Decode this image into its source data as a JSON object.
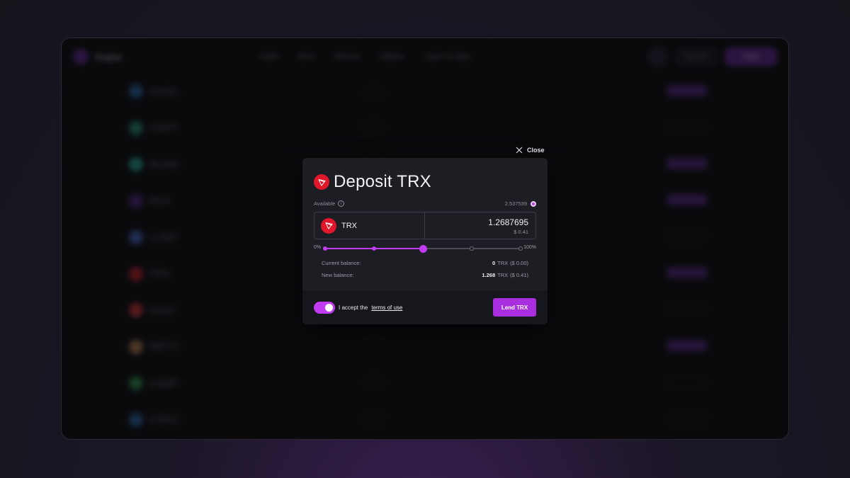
{
  "background": {
    "nav": {
      "brand": "Kujira",
      "menu": [
        "Trade",
        "Earn",
        "Borrow",
        "Utilities",
        "Learn & Help"
      ],
      "search_label": "Search",
      "start_label": "Start"
    },
    "rows": [
      {
        "coin": "USDC",
        "icon_color": "#2f6fb0",
        "cta": true
      },
      {
        "coin": "USDT",
        "icon_color": "#2a9a77",
        "cta": false
      },
      {
        "coin": "RUNE",
        "icon_color": "#26b7a5",
        "cta": true
      },
      {
        "coin": "MLA",
        "icon_color": "#5b2d8c",
        "cta": true
      },
      {
        "coin": "LUSD",
        "icon_color": "#4a6fd0",
        "cta": false
      },
      {
        "coin": "TRX",
        "icon_color": "#d02230",
        "cta": true
      },
      {
        "coin": "AVAX",
        "icon_color": "#e03a3a",
        "cta": false
      },
      {
        "coin": "WETC",
        "icon_color": "#c58a55",
        "cta": true
      },
      {
        "coin": "USDP",
        "icon_color": "#2e9a4a",
        "cta": false
      },
      {
        "coin": "USDC",
        "icon_color": "#2f6fb0",
        "cta": false
      }
    ]
  },
  "close_label": "Close",
  "modal": {
    "title": "Deposit TRX",
    "available_label": "Available",
    "available_value": "2.537539",
    "asset_symbol": "TRX",
    "amount_value": "1.2687695",
    "amount_usd": "$ 0.41",
    "slider": {
      "min_label": "0%",
      "max_label": "100%",
      "value_fraction": 0.5,
      "ticks": [
        0,
        0.25,
        0.5,
        0.75,
        1
      ]
    },
    "current_balance_label": "Current balance:",
    "current_balance_value": "0",
    "current_balance_unit": "TRX",
    "current_balance_usd": "($ 0.00)",
    "new_balance_label": "New balance:",
    "new_balance_value": "1.268",
    "new_balance_unit": "TRX",
    "new_balance_usd": "($ 0.41)",
    "accept_prefix": "I accept the",
    "terms_link": "terms of use",
    "submit_label": "Lend TRX",
    "accepted": true
  },
  "colors": {
    "accent": "#c13cf0",
    "button": "#a82ee0",
    "trx_red": "#e0162b"
  }
}
